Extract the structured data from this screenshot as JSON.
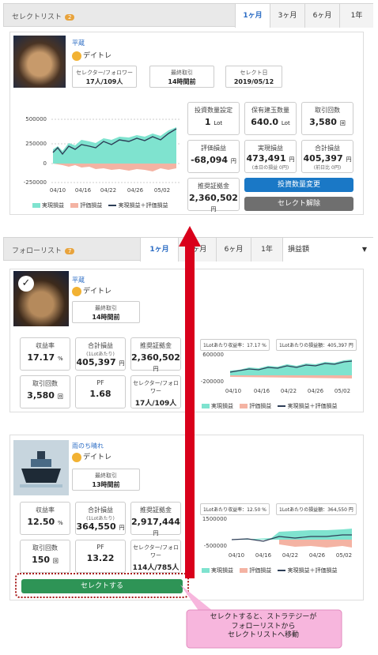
{
  "select_list": {
    "title": "セレクトリスト",
    "count": "2",
    "tabs": [
      "1ヶ月",
      "3ヶ月",
      "6ヶ月",
      "1年"
    ],
    "active_tab": "1ヶ月",
    "strategy": {
      "name": "平蔵",
      "author": "デイトレ",
      "selector_label": "セレクター/フォロワー",
      "selector_value": "17人/109人",
      "last_trade_label": "最終取引",
      "last_trade_value": "14時間前",
      "select_date_label": "セレクト日",
      "select_date_value": "2019/05/12",
      "stats": {
        "invest_qty_label": "投資数量設定",
        "invest_qty_value": "1",
        "invest_qty_unit": "Lot",
        "position_label": "保有建玉数量",
        "position_value": "640.0",
        "position_unit": "Lot",
        "trades_label": "取引回数",
        "trades_value": "3,580",
        "trades_unit": "回",
        "eval_label": "評価損益",
        "eval_value": "-68,094",
        "eval_unit": "円",
        "realized_label": "実現損益",
        "realized_value": "473,491",
        "realized_unit": "円",
        "realized_sub": "(本日の損益 0円)",
        "total_label": "合計損益",
        "total_value": "405,397",
        "total_unit": "円",
        "total_sub": "(前日比 0円)",
        "margin_label": "推奨証拠金",
        "margin_value": "2,360,502",
        "margin_unit": "円"
      },
      "change_button": "投資数量変更",
      "release_button": "セレクト解除"
    },
    "chart": {
      "yticks": [
        "500000",
        "250000",
        "0",
        "-250000"
      ],
      "xticks": [
        "04/10",
        "04/16",
        "04/22",
        "04/26",
        "05/02"
      ],
      "legend": [
        "実現損益",
        "評価損益",
        "実現損益＋評価損益"
      ]
    }
  },
  "follow_list": {
    "title": "フォローリスト",
    "count": "7",
    "tabs": [
      "1ヶ月",
      "3ヶ月",
      "6ヶ月",
      "1年"
    ],
    "sort_label": "損益額",
    "card1": {
      "name": "平蔵",
      "author": "デイトレ",
      "last_trade_label": "最終取引",
      "last_trade_value": "14時間前",
      "stats": {
        "yield_label": "収益率",
        "yield_value": "17.17",
        "yield_unit": "%",
        "total_label": "合計損益",
        "total_sub": "(1Lotあたり)",
        "total_value": "405,397",
        "total_unit": "円",
        "margin_label": "推奨証拠金",
        "margin_value": "2,360,502",
        "margin_unit": "円",
        "trades_label": "取引回数",
        "trades_value": "3,580",
        "trades_unit": "回",
        "pf_label": "PF",
        "pf_value": "1.68",
        "selector_label": "セレクター/フォロワー",
        "selector_value": "17人/109人"
      },
      "chip1": "1Lotあたり収益率：17.17 %",
      "chip2": "1Lotあたりの損益額：405,397 円",
      "yticks": [
        "600000",
        "-200000"
      ],
      "xticks": [
        "04/10",
        "04/16",
        "04/22",
        "04/26",
        "05/02"
      ],
      "legend": [
        "実現損益",
        "評価損益",
        "実現損益＋評価損益"
      ]
    },
    "card2": {
      "name": "雨のち晴れ",
      "author": "デイトレ",
      "last_trade_label": "最終取引",
      "last_trade_value": "13時間前",
      "stats": {
        "yield_label": "収益率",
        "yield_value": "12.50",
        "yield_unit": "%",
        "total_label": "合計損益",
        "total_sub": "(1Lotあたり)",
        "total_value": "364,550",
        "total_unit": "円",
        "margin_label": "推奨証拠金",
        "margin_value": "2,917,444",
        "margin_unit": "円",
        "trades_label": "取引回数",
        "trades_value": "150",
        "trades_unit": "回",
        "pf_label": "PF",
        "pf_value": "13.22",
        "selector_label": "セレクター/フォロワー",
        "selector_value": "114人/785人"
      },
      "chip1": "1Lotあたり収益率：12.50 %",
      "chip2": "1Lotあたりの損益額：364,550 円",
      "yticks": [
        "1500000",
        "-500000"
      ],
      "xticks": [
        "04/10",
        "04/16",
        "04/22",
        "04/26",
        "05/02"
      ],
      "legend": [
        "実現損益",
        "評価損益",
        "実現損益＋評価損益"
      ],
      "select_button": "セレクトする"
    }
  },
  "callout": {
    "line1": "セレクトすると、ストラテジーが",
    "line2": "フォローリストから",
    "line3": "セレクトリストへ移動"
  },
  "colors": {
    "realized": "#7fe3cf",
    "eval": "#f4b3a3",
    "combined": "#2d3e57",
    "accent": "#2b6cc4",
    "arrow": "#d9001b",
    "callout_bg": "#f7b6dd"
  }
}
